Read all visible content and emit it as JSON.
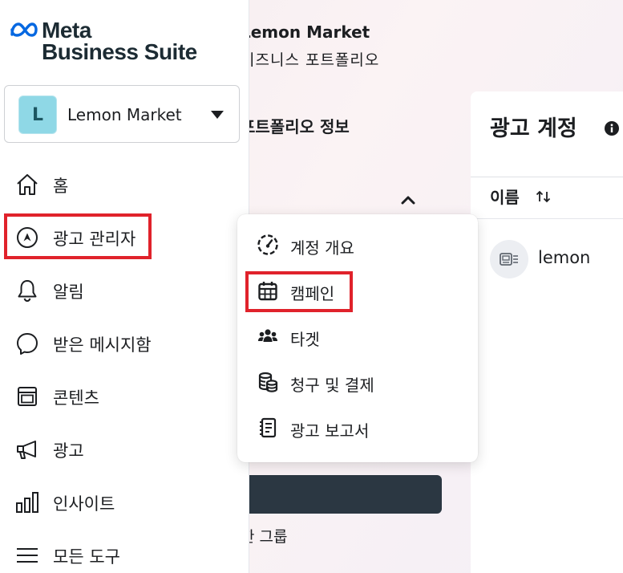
{
  "background": {
    "business_name": "Lemon Market",
    "business_subtitle": "비즈니스 포트폴리오",
    "portfolio_heading": "포트폴리오 정보",
    "group_text": "한 그룹",
    "ad_accounts": {
      "title": "광고 계정",
      "column_name": "이름",
      "rows": [
        {
          "name": "lemon"
        }
      ]
    }
  },
  "sidebar": {
    "logo_line1": "Meta",
    "logo_line2": "Business Suite",
    "account": {
      "initial": "L",
      "name": "Lemon Market"
    },
    "items": [
      {
        "label": "홈",
        "icon": "home-icon"
      },
      {
        "label": "광고 관리자",
        "icon": "ads-manager-icon"
      },
      {
        "label": "알림",
        "icon": "bell-icon"
      },
      {
        "label": "받은 메시지함",
        "icon": "chat-bubble-icon"
      },
      {
        "label": "콘텐츠",
        "icon": "content-icon"
      },
      {
        "label": "광고",
        "icon": "megaphone-icon"
      },
      {
        "label": "인사이트",
        "icon": "bar-chart-icon"
      },
      {
        "label": "모든 도구",
        "icon": "menu-lines-icon"
      }
    ]
  },
  "flyout": {
    "items": [
      {
        "label": "계정 개요",
        "icon": "gauge-icon"
      },
      {
        "label": "캠페인",
        "icon": "calendar-icon"
      },
      {
        "label": "타겟",
        "icon": "audience-icon"
      },
      {
        "label": "청구 및 결제",
        "icon": "coins-icon"
      },
      {
        "label": "광고 보고서",
        "icon": "report-icon"
      }
    ]
  },
  "colors": {
    "highlight": "#e0222b",
    "meta_blue": "#0668e1",
    "dark_button": "#2b3742",
    "avatar_teal": "#8fd8e6"
  }
}
